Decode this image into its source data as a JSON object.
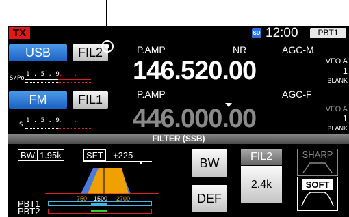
{
  "status": {
    "tx": "TX",
    "sd": "SD",
    "time": "12:00",
    "pbt": "PBT1"
  },
  "vfo_main": {
    "mode": "USB",
    "filter": "FIL2",
    "pamp": "P.AMP",
    "nr": "NR",
    "agc": "AGC-M",
    "frequency": "146.520.00",
    "vfo_label": "VFO A",
    "vfo_num": "1",
    "blank": "BLANK",
    "meter_label": "S/Po",
    "meter_scale": "1 . 5 . 9",
    "meter_plus": ". . ."
  },
  "vfo_sub": {
    "mode": "FM",
    "filter": "FIL1",
    "pamp": "P.AMP",
    "agc": "AGC-F",
    "frequency": "446.000.00",
    "vfo_label": "VFO A",
    "vfo_num": "1",
    "blank": "BLANK",
    "meter_label": "S",
    "meter_scale": "1 . 5 . 9",
    "meter_plus": ". . ."
  },
  "filter_panel": {
    "title": "FILTER (SSB)",
    "bw_label": "BW",
    "bw_value": "1.95k",
    "sft_label": "SFT",
    "sft_value": "+225",
    "passband_low": "750",
    "passband_center": "1500",
    "passband_high": "2700",
    "pbt1": "PBT1",
    "pbt2": "PBT2",
    "bw_button": "BW",
    "def_button": "DEF",
    "fil_label": "FIL2",
    "fil_value": "2.4k",
    "sharp": "SHARP",
    "soft": "SOFT"
  },
  "colors": {
    "accent_blue": "#1c62c4",
    "tx_red": "#e01818",
    "passband_orange": "#f0a000",
    "passband_blue": "#4a7ae0",
    "pbt1_cyan": "#3cb8e8",
    "pbt2_green": "#2ad02a"
  }
}
